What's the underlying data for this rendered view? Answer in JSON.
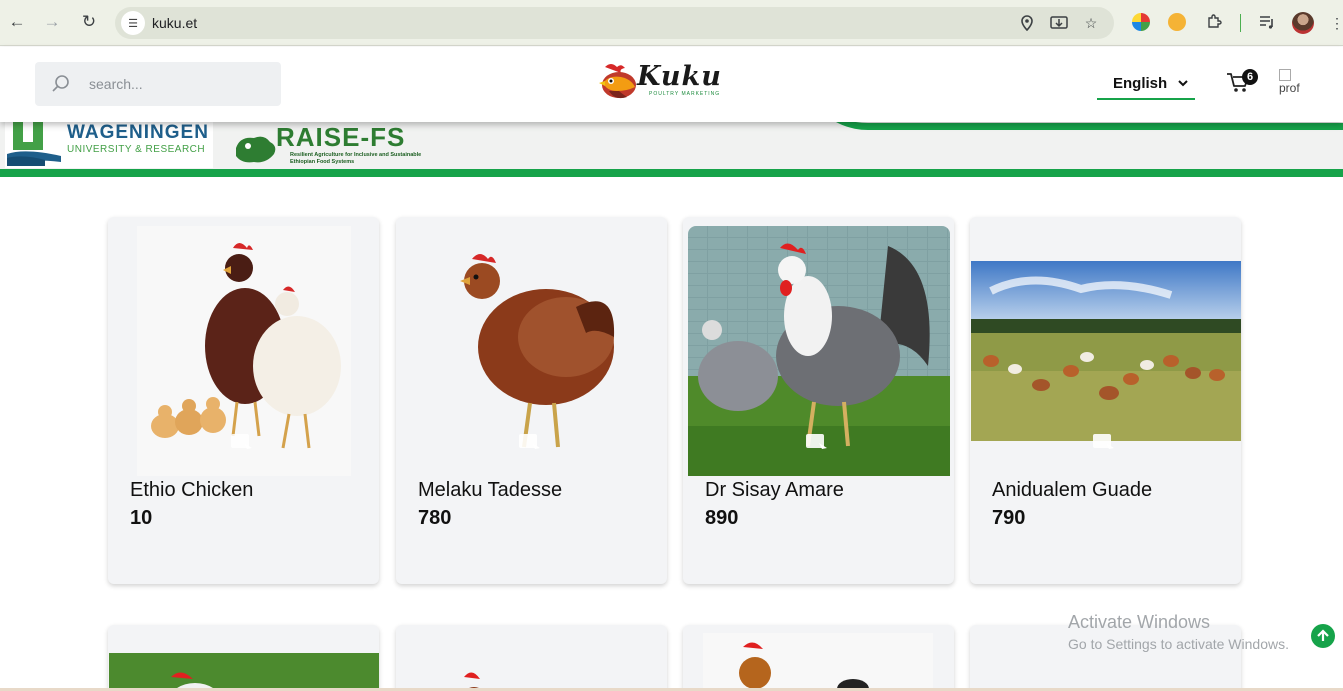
{
  "browser": {
    "url": "kuku.et"
  },
  "header": {
    "search": {
      "placeholder": "search...",
      "value": ""
    },
    "logo_text": "Kuku",
    "logo_tagline": "POULTRY MARKETING",
    "language": "English",
    "cart_count": "6",
    "profile_alt": "prof"
  },
  "partners": {
    "wageningen": {
      "title": "WAGENINGEN",
      "subtitle": "UNIVERSITY & RESEARCH"
    },
    "raise": {
      "title": "RAISE-FS",
      "subtitle": "Resilient Agriculture for Inclusive and Sustainable Ethiopian Food Systems"
    }
  },
  "products": [
    {
      "name": "Ethio Chicken",
      "price": "10"
    },
    {
      "name": "Melaku Tadesse",
      "price": "780"
    },
    {
      "name": "Dr Sisay Amare",
      "price": "890"
    },
    {
      "name": "Anidualem Guade",
      "price": "790"
    }
  ],
  "watermark": {
    "title": "Activate Windows",
    "subtitle": "Go to Settings to activate Windows."
  }
}
